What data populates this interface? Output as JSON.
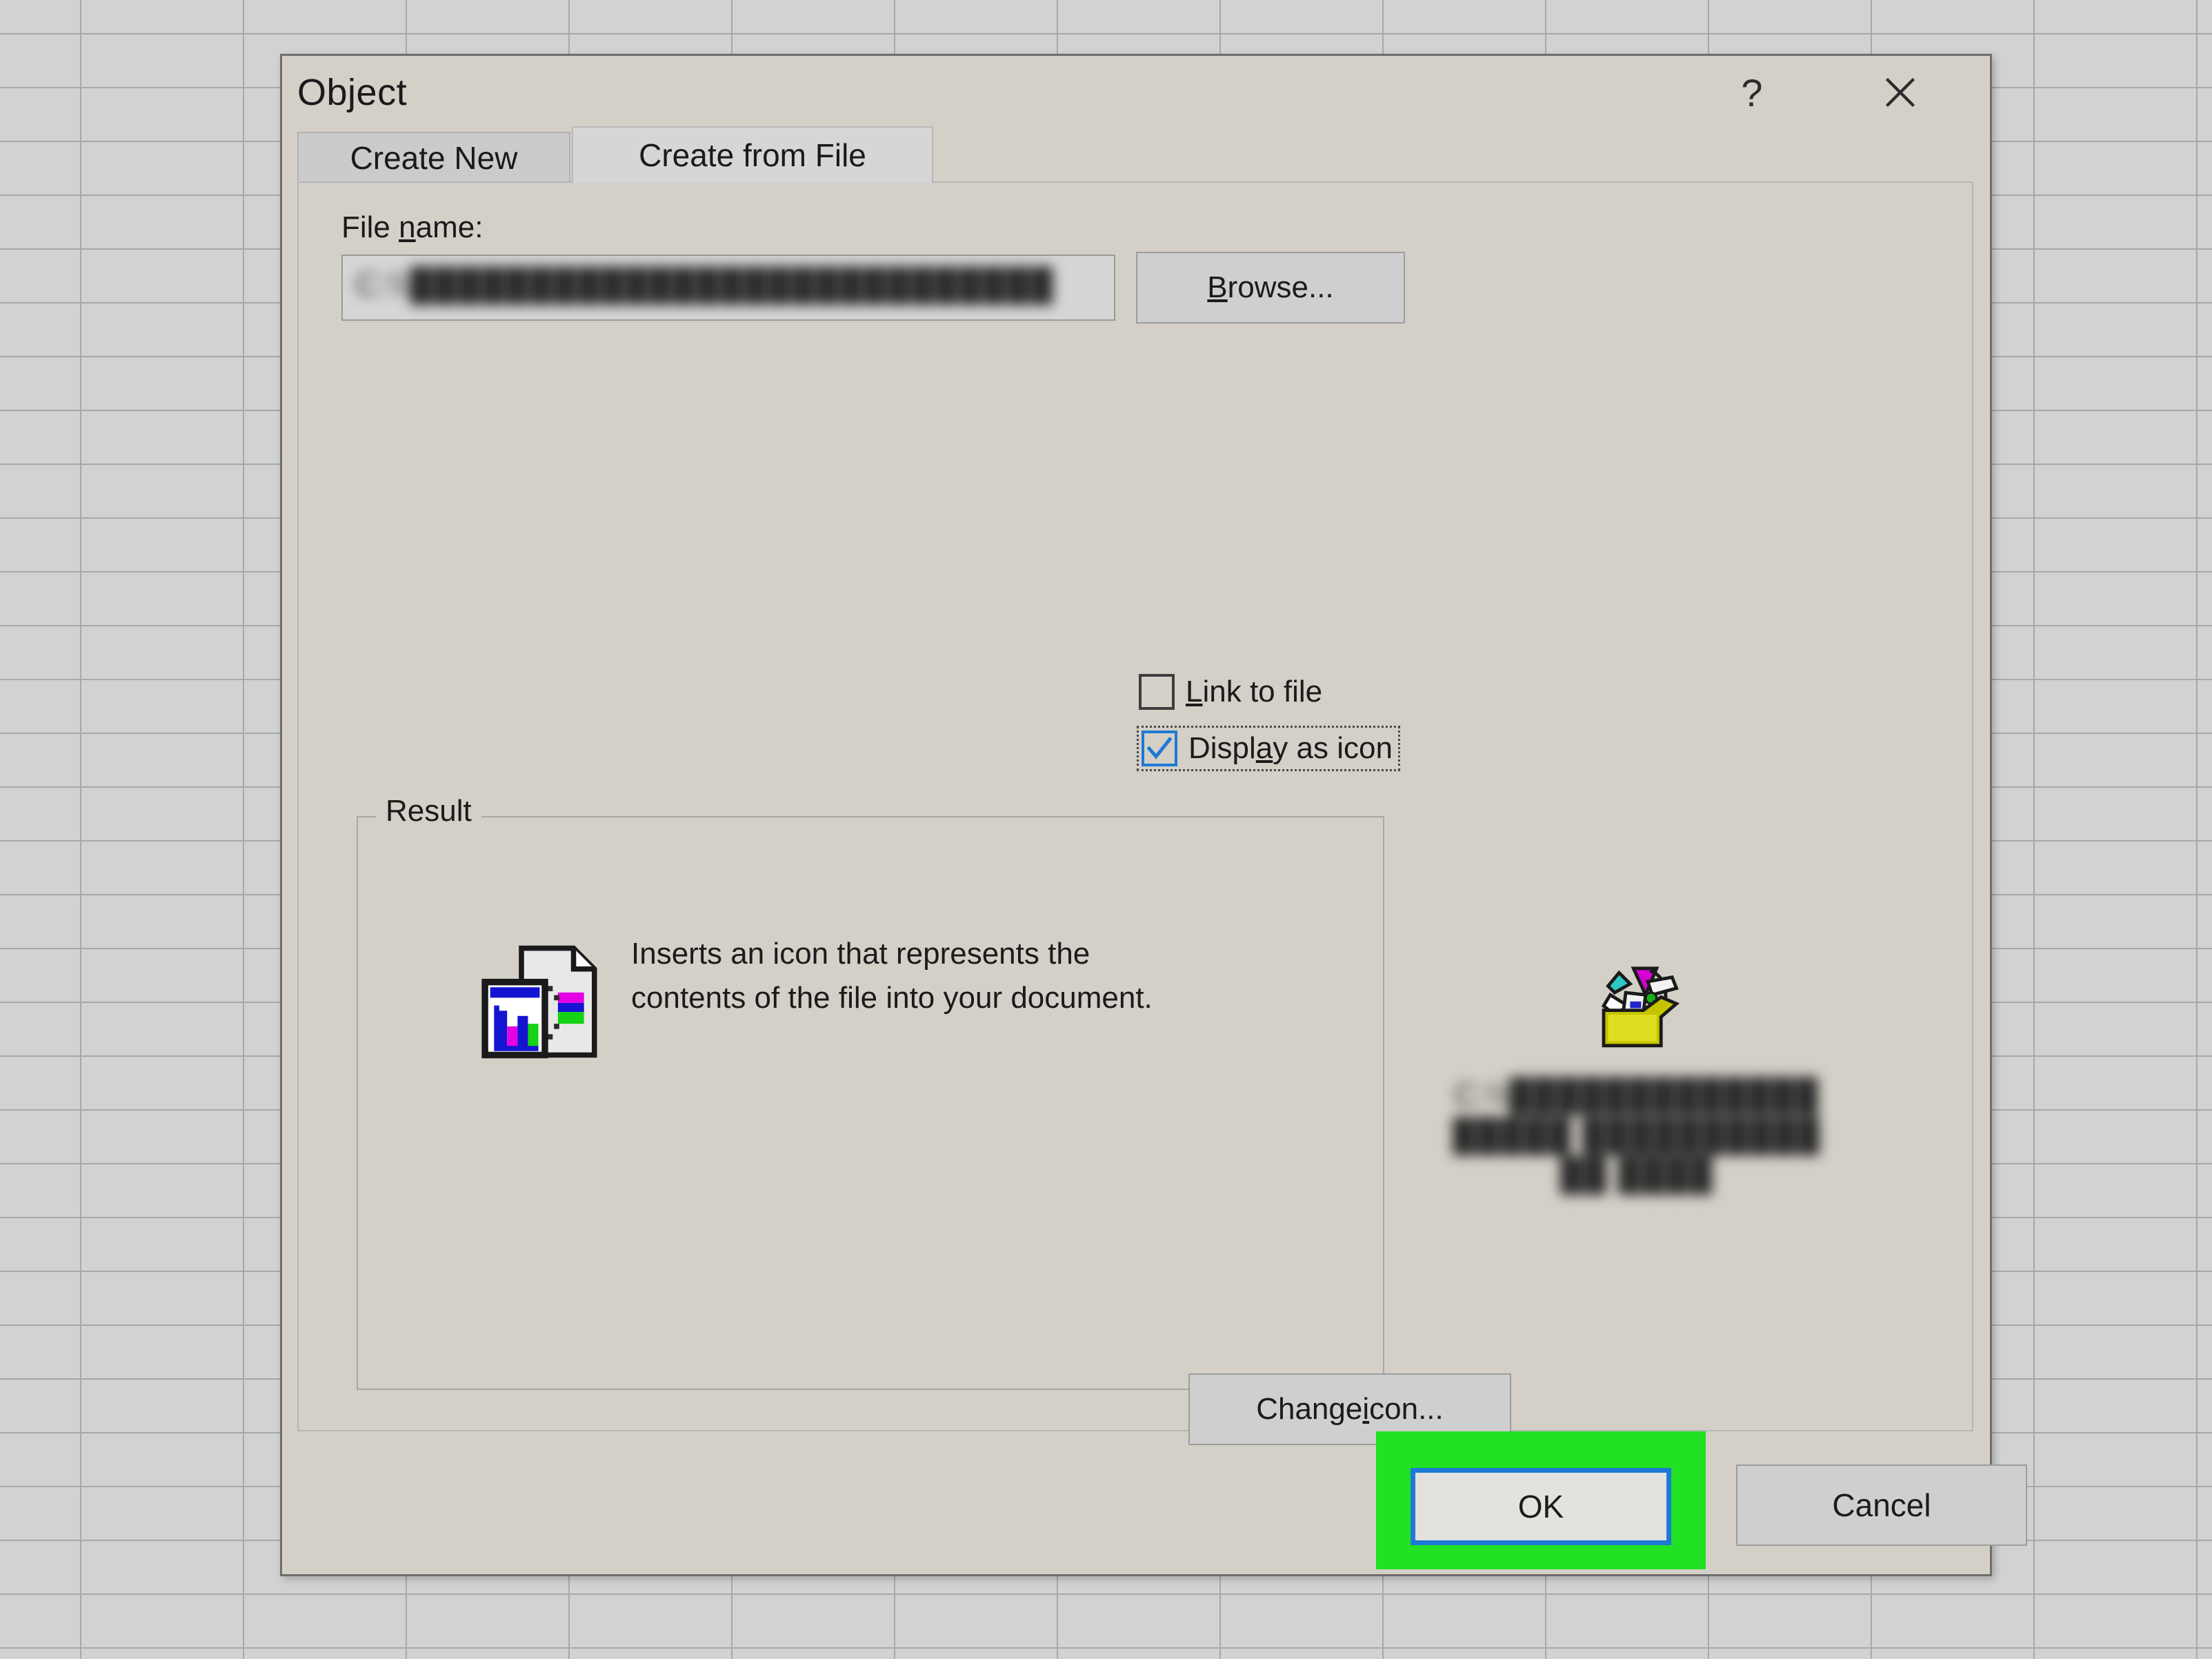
{
  "background": {
    "app": "spreadsheet-grid",
    "cell_fill": "#d2d2d2",
    "gridline_color": "#a8a8a8"
  },
  "dialog": {
    "title": "Object",
    "help_icon": "?",
    "close_icon": "close-icon",
    "tabs": [
      {
        "label": "Create New",
        "selected": false
      },
      {
        "label": "Create from File",
        "selected": true
      }
    ],
    "file_name": {
      "label": "File name:",
      "label_accel": "n",
      "value": "C:\\\\███████████████████████████",
      "value_redacted": true,
      "placeholder": ""
    },
    "browse_button": {
      "label": "Browse...",
      "accel": "B"
    },
    "checkboxes": [
      {
        "name": "link-to-file",
        "label": "Link to file",
        "accel": "L",
        "checked": false,
        "focused": false
      },
      {
        "name": "display-as-icon",
        "label": "Display as icon",
        "accel": "a",
        "checked": true,
        "focused": true
      }
    ],
    "result": {
      "legend": "Result",
      "description": "Inserts an icon that represents the contents of the file into your document.",
      "icon": "document-with-chart-icon"
    },
    "icon_preview": {
      "icon": "package-box-icon",
      "caption": "C:\\\\██████████████████ ████████████ ████",
      "caption_redacted": true
    },
    "change_icon_button": {
      "label": "Change icon...",
      "accel": "i"
    },
    "footer": {
      "ok_button": {
        "label": "OK",
        "is_default": true,
        "highlighted": true,
        "highlight_color": "#22e122",
        "focus_border_color": "#1e7ad4"
      },
      "cancel_button": {
        "label": "Cancel"
      }
    }
  }
}
